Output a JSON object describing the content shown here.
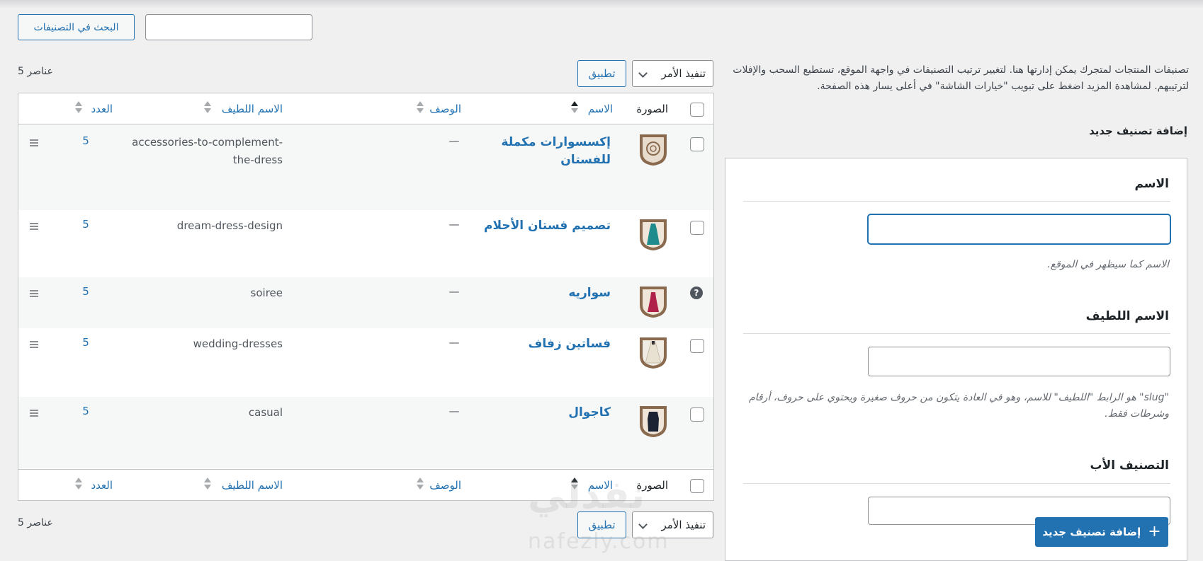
{
  "search": {
    "button_label": "البحث في التصنيفات",
    "input_value": ""
  },
  "bulk": {
    "select_label": "تنفيذ الأمر",
    "apply_label": "تطبيق",
    "count_label": "5 عناصر"
  },
  "table": {
    "columns": {
      "image": "الصورة",
      "name": "الاسم",
      "description": "الوصف",
      "slug": "الاسم اللطيف",
      "count": "العدد"
    },
    "rows": [
      {
        "name": "إكسسوارات مكملة للفستان",
        "description": "—",
        "slug": "accessories-to-complement-the-dress",
        "count": "5",
        "thumb_color": "#c9b9a6",
        "item_color": "#e7dccd",
        "has_checkbox": true
      },
      {
        "name": "تصميم فستان الأحلام",
        "description": "—",
        "slug": "dream-dress-design",
        "count": "5",
        "thumb_color": "#c9b9a6",
        "item_color": "#1f8b8c",
        "has_checkbox": true
      },
      {
        "name": "سواريه",
        "description": "—",
        "slug": "soiree",
        "count": "5",
        "thumb_color": "#c9b9a6",
        "item_color": "#b0214a",
        "has_checkbox": false
      },
      {
        "name": "فساتين زفاف",
        "description": "—",
        "slug": "wedding-dresses",
        "count": "5",
        "thumb_color": "#c9b9a6",
        "item_color": "#efe9dd",
        "has_checkbox": true
      },
      {
        "name": "كاجوال",
        "description": "—",
        "slug": "casual",
        "count": "5",
        "thumb_color": "#c9b9a6",
        "item_color": "#1c2433",
        "has_checkbox": true
      }
    ]
  },
  "right": {
    "description": "تصنيفات المنتجات لمتجرك يمكن إدارتها هنا. لتغيير ترتيب التصنيفات في واجهة الموقع، تستطيع السحب والإفلات لترتيبهم. لمشاهدة المزيد اضغط على تبويب \"خيارات الشاشة\" في أعلى يسار هذه الصفحة.",
    "add_title": "إضافة تصنيف جديد",
    "name_label": "الاسم",
    "name_help": "الاسم كما سيظهر في الموقع.",
    "slug_label": "الاسم اللطيف",
    "slug_help": "\"slug\" هو الرابط \"اللطيف\" للاسم، وهو في العادة يتكون من حروف صغيرة ويحتوي على حروف، أرقام وشرطات فقط.",
    "parent_label": "التصنيف الأب",
    "add_button": "إضافة تصنيف جديد"
  },
  "watermark": {
    "arabic": "نفذلي",
    "latin": "nafezly.com"
  },
  "colors": {
    "accent": "#2271b1",
    "thumb_frame": "#8a6a4f"
  }
}
